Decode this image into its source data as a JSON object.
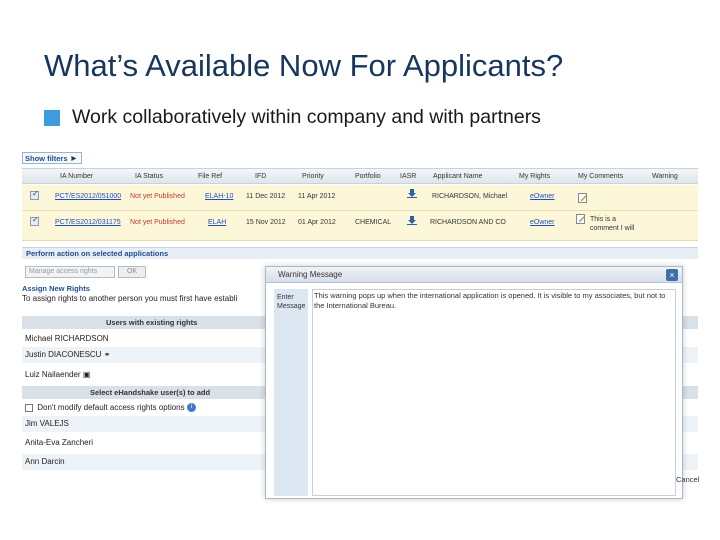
{
  "slide": {
    "title": "What’s Available Now For Applicants?",
    "bullet": "Work collaboratively within company and with partners"
  },
  "filters": {
    "label": "Show filters"
  },
  "grid": {
    "headers": [
      "IA Number",
      "IA Status",
      "File Ref",
      "IFD",
      "Priority",
      "Portfolio",
      "IASR",
      "Applicant Name",
      "My Rights",
      "My Comments",
      "Warning"
    ],
    "rows": [
      {
        "ia_number": "PCT/ES2012/051000",
        "status": "Not yet Published",
        "file_ref": "ELAH-10",
        "ifd": "11 Dec 2012",
        "priority": "11 Apr 2012",
        "portfolio": "",
        "applicant": "RICHARDSON, Michael",
        "rights": "eOwner",
        "comment": ""
      },
      {
        "ia_number": "PCT/ES2012/031175",
        "status": "Not yet Published",
        "file_ref": "ELAH",
        "ifd": "15 Nov 2012",
        "priority": "01 Apr 2012",
        "portfolio": "CHEMICAL",
        "applicant": "RICHARDSON AND CO",
        "rights": "eOwner",
        "comment": "This is a comment I will"
      }
    ]
  },
  "perform": {
    "title": "Perform action on selected applications",
    "select_placeholder": "Manage access rights",
    "ok_label": "OK"
  },
  "assign": {
    "title": "Assign New Rights",
    "hint": "To assign rights to another person you must first have establi"
  },
  "existing_users": {
    "header": "Users with existing rights",
    "users": [
      "Michael RICHARDSON",
      "Justin DIACONESCU",
      "Luiz Nailaender"
    ]
  },
  "add_users": {
    "header": "Select eHandshake user(s) to add",
    "default_option": "Don't modify default access rights options",
    "users": [
      "Jim VALEJS",
      "Anita-Eva Zancheri",
      "Ann Darcin"
    ]
  },
  "modal": {
    "title": "Warning Message",
    "close": "×",
    "label": "Enter Message",
    "text": "This warning pops up when the international application is opened. It is visible to my associates, but not to the International Bureau.",
    "cancel": "Cancel"
  }
}
